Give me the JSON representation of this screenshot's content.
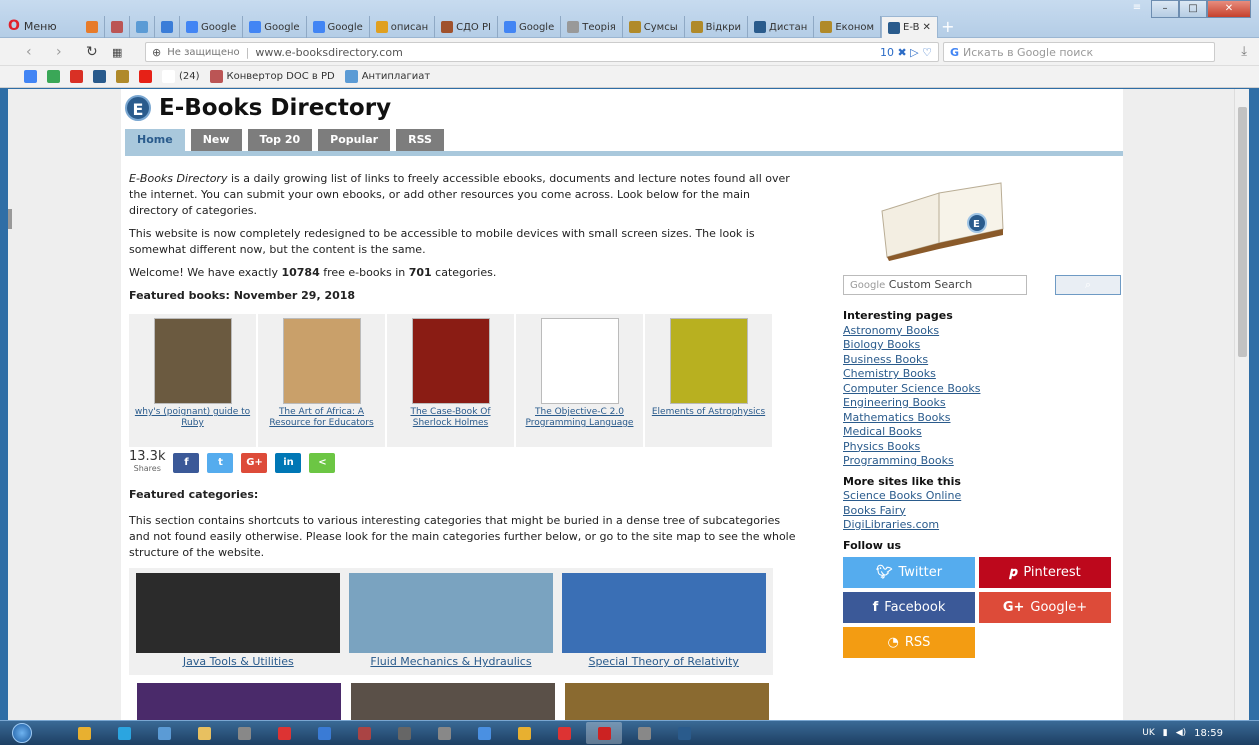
{
  "browser": {
    "menu_label": "Меню",
    "tabs": [
      {
        "label": "",
        "color": "#e77b2a"
      },
      {
        "label": "",
        "color": "#b55"
      },
      {
        "label": "",
        "color": "#5b9bd5"
      },
      {
        "label": "",
        "color": "#3b7dd8"
      },
      {
        "label": "Google",
        "color": "#4285f4"
      },
      {
        "label": "Google",
        "color": "#4285f4"
      },
      {
        "label": "Google",
        "color": "#4285f4"
      },
      {
        "label": "описан",
        "color": "#e0a020"
      },
      {
        "label": "СДО РІ",
        "color": "#a0522d"
      },
      {
        "label": "Google",
        "color": "#4285f4"
      },
      {
        "label": "Теорія",
        "color": "#999"
      },
      {
        "label": "Сумсы",
        "color": "#b08a2a"
      },
      {
        "label": "Відкри",
        "color": "#b08a2a"
      },
      {
        "label": "Дистан",
        "color": "#2a5b8c"
      },
      {
        "label": "Економ",
        "color": "#b08a2a"
      },
      {
        "label": "E-B",
        "color": "#2a5b8c"
      }
    ],
    "insecure_label": "Не защищено",
    "url": "www.e-booksdirectory.com",
    "url_badge": "10",
    "search_placeholder": "Искать в Google поиск",
    "bookmarks": [
      {
        "label": "",
        "color": "#4285f4"
      },
      {
        "label": "",
        "color": "#3aa757"
      },
      {
        "label": "",
        "color": "#d93025"
      },
      {
        "label": "",
        "color": "#2a5b8c"
      },
      {
        "label": "",
        "color": "#b08a2a"
      },
      {
        "label": "",
        "color": "#e62117"
      },
      {
        "label": "(24)",
        "color": "#fff"
      },
      {
        "label": "Конвертор DOC в PD",
        "color": "#b55"
      },
      {
        "label": "Антиплагиат",
        "color": "#5b9bd5"
      }
    ]
  },
  "site": {
    "title": "E-Books Directory",
    "logo_letter": "E",
    "nav": [
      "Home",
      "New",
      "Top 20",
      "Popular",
      "RSS"
    ],
    "intro_em": "E-Books Directory",
    "intro_rest": " is a daily growing list of links to freely accessible ebooks, documents and lecture notes found all over the internet. You can submit your own ebooks, or add other resources you come across. Look below for the main directory of categories.",
    "redesign_text": "This website is now completely redesigned to be accessible to mobile devices with small screen sizes. The look is somewhat different now, but the content is the same.",
    "welcome_pre": "Welcome! We have exactly ",
    "welcome_count": "10784",
    "welcome_mid": " free e-books in ",
    "welcome_cats": "701",
    "welcome_post": " categories.",
    "featured_books_heading": "Featured books: November 29, 2018",
    "books": [
      {
        "title": "why's (poignant) guide to Ruby",
        "color": "#6b5a40"
      },
      {
        "title": "The Art of Africa: A Resource for Educators",
        "color": "#c9a06a"
      },
      {
        "title": "The Case-Book Of Sherlock Holmes",
        "color": "#8a1c14"
      },
      {
        "title": "The Objective-C 2.0 Programming Language",
        "color": "#ffffff"
      },
      {
        "title": "Elements of Astrophysics",
        "color": "#b8b020"
      }
    ],
    "share_count": "13.3k",
    "share_label": "Shares",
    "share_buttons": [
      {
        "label": "f",
        "color": "#3b5998"
      },
      {
        "label": "t",
        "color": "#55acee"
      },
      {
        "label": "G+",
        "color": "#dd4b39"
      },
      {
        "label": "in",
        "color": "#0077b5"
      },
      {
        "label": "<",
        "color": "#6cc644"
      }
    ],
    "featured_cats_heading": "Featured categories:",
    "featured_cats_text": "This section contains shortcuts to various interesting categories that might be buried in a dense tree of subcategories and not found easily otherwise. Please look for the main categories further below, or go to the site map to see the whole structure of the website.",
    "categories": [
      {
        "label": "Java Tools & Utilities",
        "color": "#2b2b2b"
      },
      {
        "label": "Fluid Mechanics & Hydraulics",
        "color": "#7aa3c0"
      },
      {
        "label": "Special Theory of Relativity",
        "color": "#3a6fb5"
      }
    ],
    "categories_row2": [
      {
        "color": "#4a2a6a"
      },
      {
        "color": "#5a5048"
      },
      {
        "color": "#8a6a30"
      }
    ]
  },
  "sidebar": {
    "search_brand": "Google",
    "search_placeholder": "Custom Search",
    "search_button_icon": "search-icon",
    "interesting_heading": "Interesting pages",
    "interesting_links": [
      "Astronomy Books",
      "Biology Books",
      "Business Books",
      "Chemistry Books",
      "Computer Science Books",
      "Engineering Books",
      "Mathematics Books",
      "Medical Books",
      "Physics Books",
      "Programming Books"
    ],
    "more_heading": "More sites like this",
    "more_links": [
      "Science Books Online",
      "Books Fairy",
      "DigiLibraries.com"
    ],
    "follow_heading": "Follow us",
    "follow": [
      {
        "label": "Twitter",
        "icon": "bird",
        "color": "#55acee"
      },
      {
        "label": "Pinterest",
        "icon": "P",
        "color": "#bd081c"
      },
      {
        "label": "Facebook",
        "icon": "f",
        "color": "#3b5998"
      },
      {
        "label": "Google+",
        "icon": "G+",
        "color": "#dd4b39"
      },
      {
        "label": "RSS",
        "icon": "rss",
        "color": "#f39c12"
      }
    ]
  },
  "taskbar": {
    "lang": "UK",
    "time": "18:59",
    "apps": [
      "#e8b030",
      "#2ba5e0",
      "#5b9bd5",
      "#e8c060",
      "#888",
      "#d33",
      "#3a7bd5",
      "#a44",
      "#666",
      "#888",
      "#4a90e2",
      "#e8b030",
      "#d33",
      "#c22",
      "#888",
      "#2a5b8c"
    ]
  }
}
